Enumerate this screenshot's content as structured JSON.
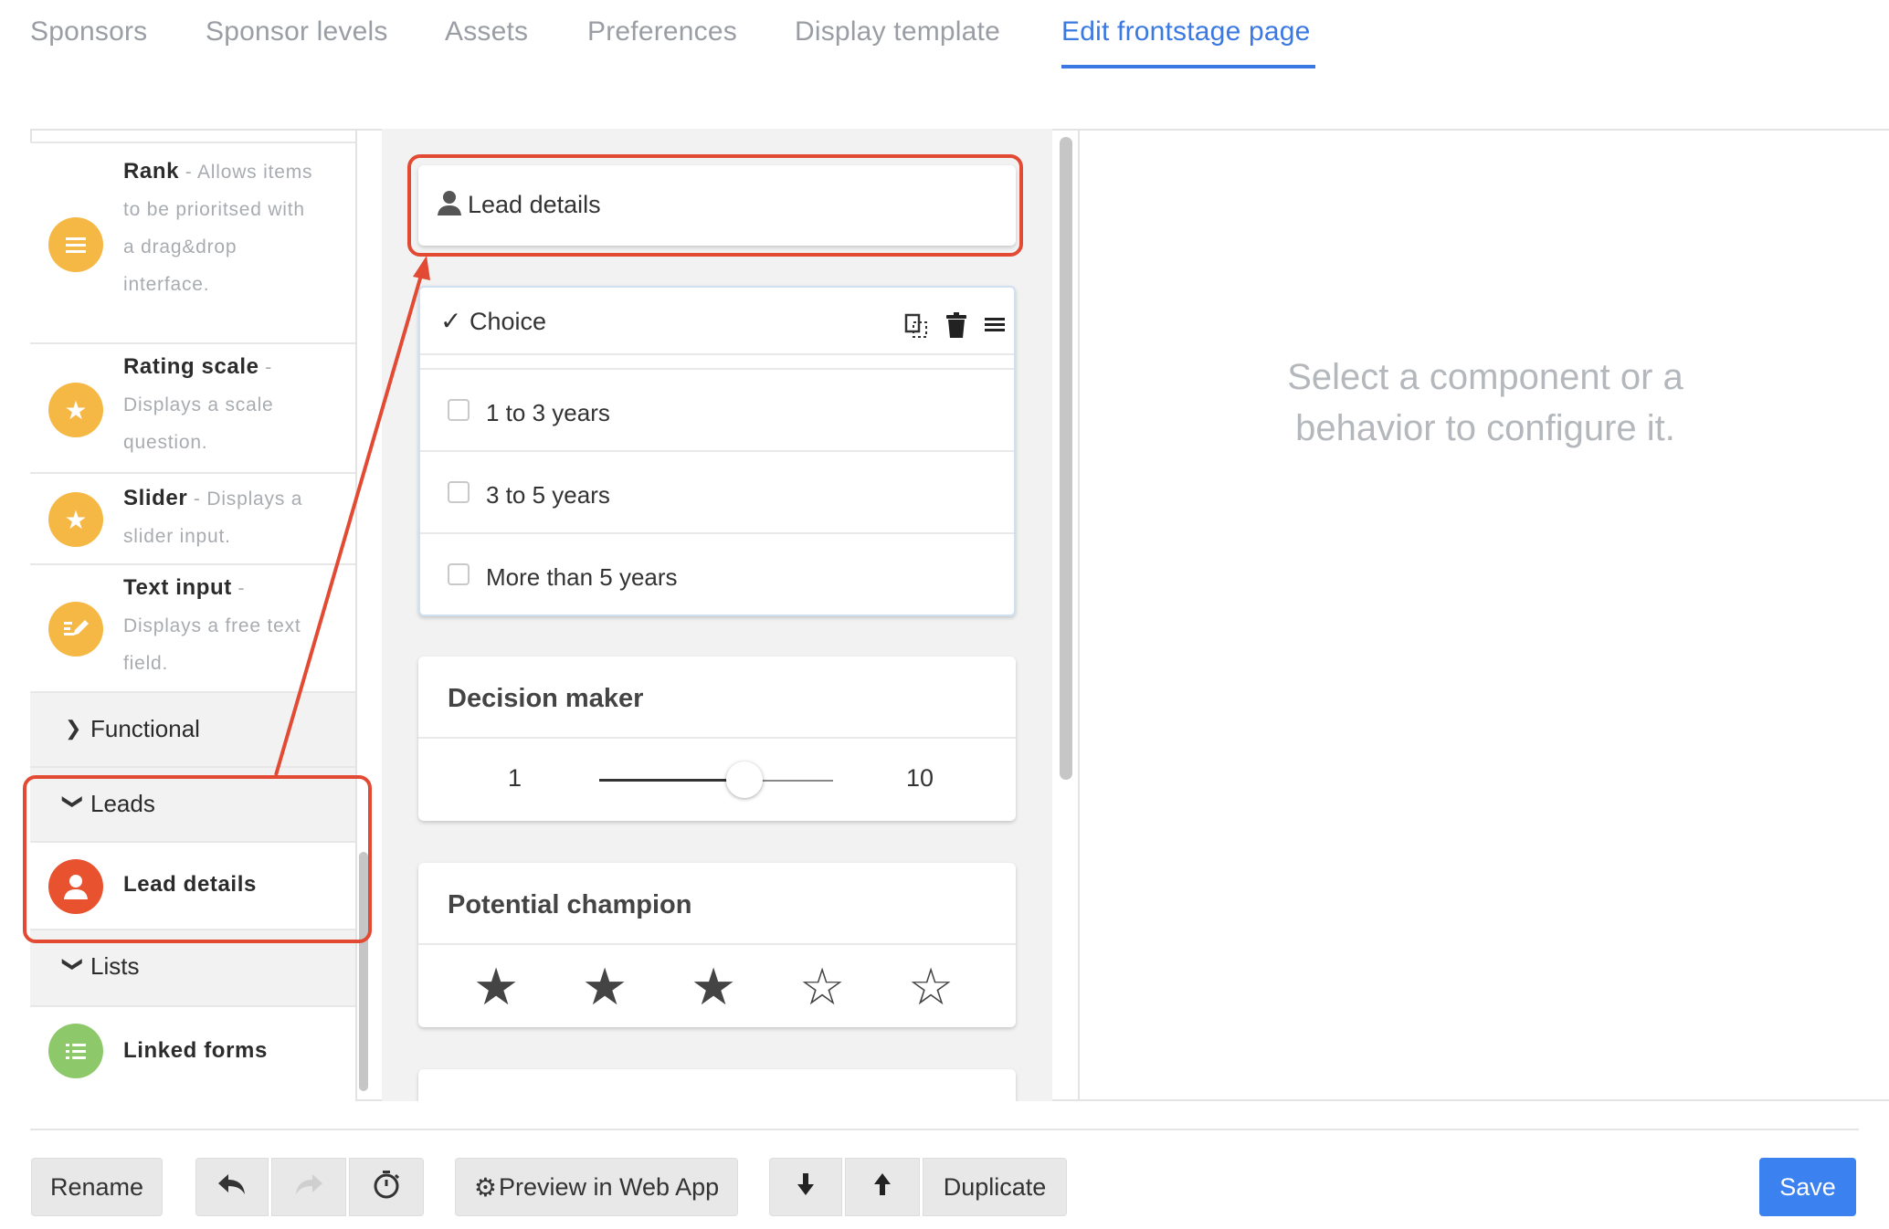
{
  "tabs": [
    {
      "label": "Sponsors"
    },
    {
      "label": "Sponsor levels"
    },
    {
      "label": "Assets"
    },
    {
      "label": "Preferences"
    },
    {
      "label": "Display template"
    },
    {
      "label": "Edit frontstage page",
      "active": true
    }
  ],
  "palette": {
    "items": [
      {
        "name": "Rank",
        "desc": " - Allows items to be prioritsed with a drag&drop interface.",
        "icon": "rank-icon",
        "color": "#f5b844"
      },
      {
        "name": "Rating scale",
        "desc": " - Displays a scale question.",
        "icon": "star-icon",
        "color": "#f5b844"
      },
      {
        "name": "Slider",
        "desc": " - Displays a slider input.",
        "icon": "star-icon",
        "color": "#f5b844"
      },
      {
        "name": "Text input",
        "desc": " - Displays a free text field.",
        "icon": "edit-icon",
        "color": "#f5b844"
      }
    ],
    "categories": {
      "functional": "Functional",
      "leads": "Leads",
      "lists": "Lists"
    },
    "lead_details": {
      "name": "Lead details",
      "icon": "person-icon",
      "color": "#e8522f"
    },
    "linked_forms": {
      "name": "Linked forms",
      "icon": "list-icon",
      "color": "#8dc96a"
    }
  },
  "canvas": {
    "lead_card": {
      "label": "Lead details"
    },
    "choice_card": {
      "label": "Choice",
      "options": [
        "1 to 3 years",
        "3 to 5 years",
        "More than 5 years"
      ]
    },
    "decision_card": {
      "title": "Decision maker",
      "min": "1",
      "max": "10",
      "value_fraction": 0.62
    },
    "champion_card": {
      "title": "Potential champion",
      "rating": 3,
      "max_rating": 5
    }
  },
  "config": {
    "message": "Select a component or a behavior to configure it."
  },
  "footer": {
    "rename": "Rename",
    "preview": "Preview in Web App",
    "duplicate": "Duplicate",
    "save": "Save"
  },
  "colors": {
    "accent": "#3a78e2",
    "annotation": "#e24a33",
    "save_button": "#3b82f0"
  }
}
